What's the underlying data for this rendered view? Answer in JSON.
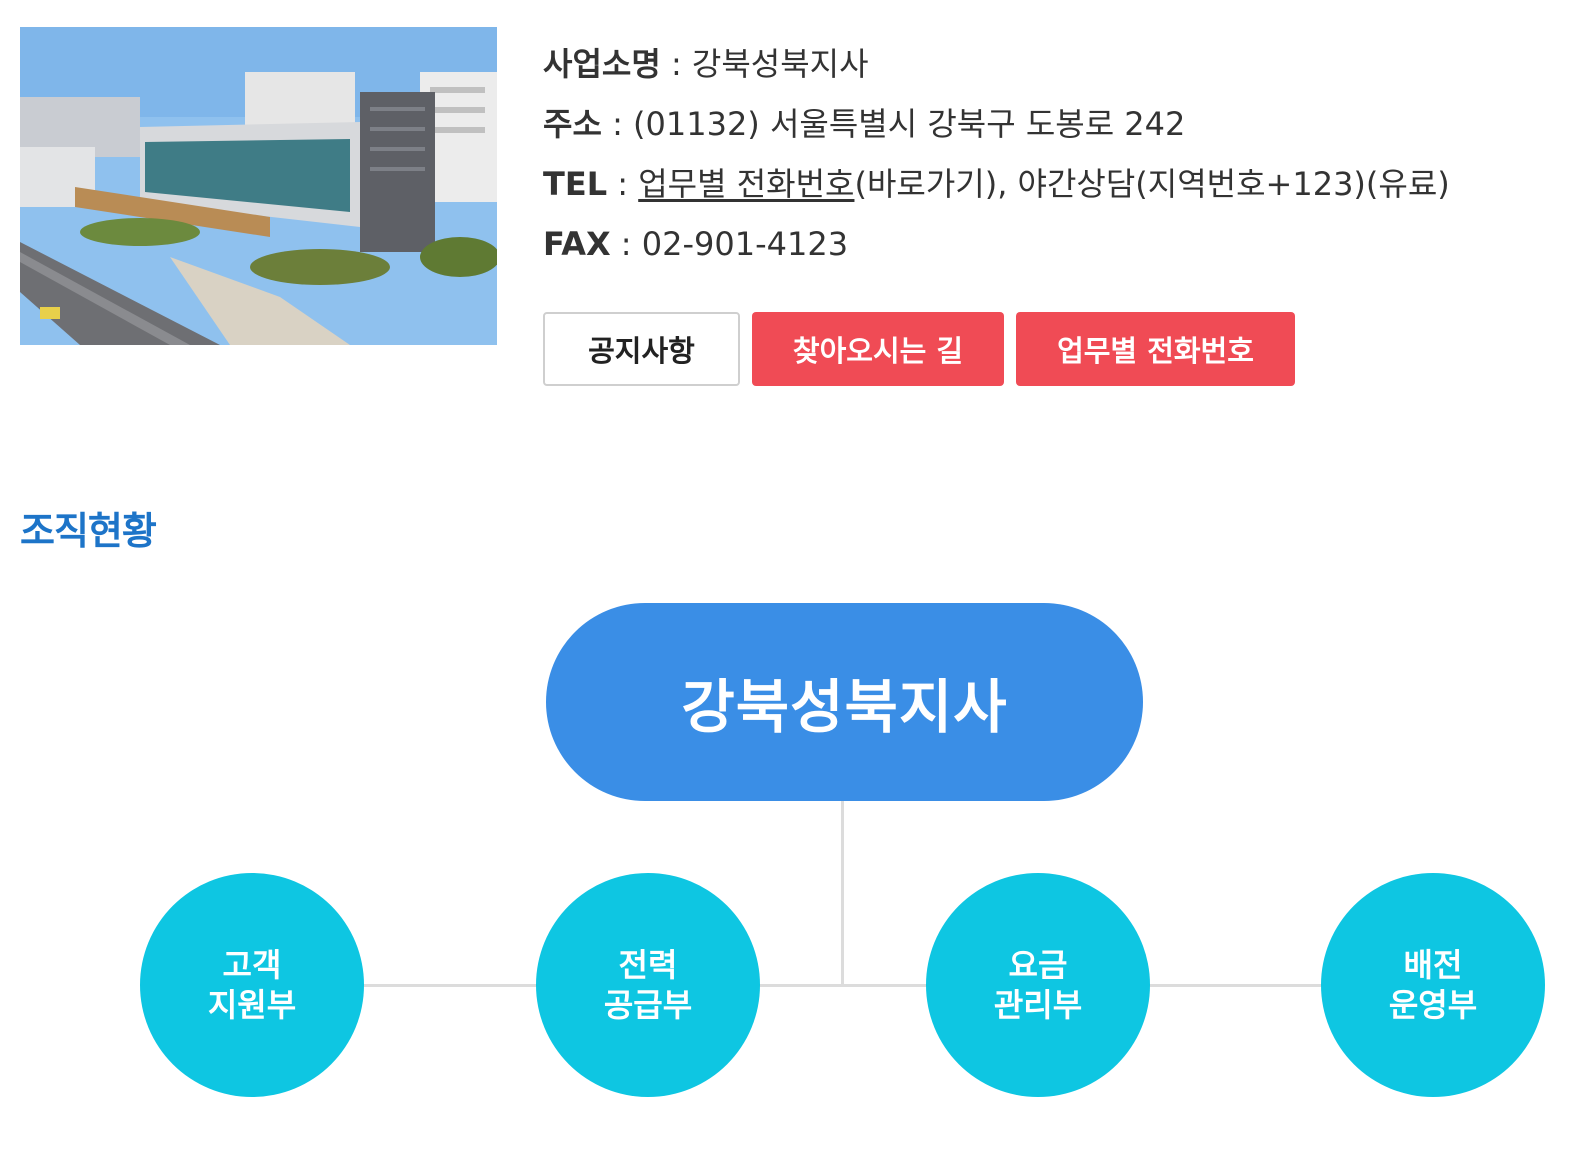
{
  "branch": {
    "name_label": "사업소명",
    "name_value": "강북성북지사",
    "address_label": "주소",
    "address_value": "(01132) 서울특별시 강북구 도봉로 242",
    "tel_label": "TEL",
    "tel_link": "업무별 전화번호",
    "tel_rest": "(바로가기), 야간상담(지역번호+123)(유료)",
    "fax_label": "FAX",
    "fax_value": "02-901-4123",
    "separator": " : "
  },
  "buttons": {
    "notice": "공지사항",
    "directions": "찾아오시는 길",
    "phone_directory": "업무별 전화번호"
  },
  "section": {
    "title": "조직현황"
  },
  "org_chart": {
    "root": "강북성북지사",
    "departments": [
      {
        "line1": "고객",
        "line2": "지원부"
      },
      {
        "line1": "전력",
        "line2": "공급부"
      },
      {
        "line1": "요금",
        "line2": "관리부"
      },
      {
        "line1": "배전",
        "line2": "운영부"
      }
    ]
  },
  "colors": {
    "primary_button": "#f04b55",
    "section_title": "#1d74c8",
    "root_node": "#3a8ee6",
    "dept_node": "#0ec6e2"
  }
}
